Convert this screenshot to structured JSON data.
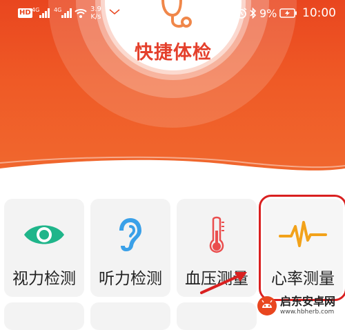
{
  "status_bar": {
    "hd_badge": "HD",
    "signal_1_label": "4G",
    "signal_2_label": "4G",
    "net_speed_value": "3.9",
    "net_speed_unit": "K/s",
    "battery_percent": "9%",
    "time": "10:00"
  },
  "hero": {
    "quick_check_label": "快捷体检"
  },
  "tiles": [
    {
      "label": "视力检测",
      "icon": "eye-icon",
      "color": "#1fb58a"
    },
    {
      "label": "听力检测",
      "icon": "ear-icon",
      "color": "#3aa0e8"
    },
    {
      "label": "血压测量",
      "icon": "thermometer-icon",
      "color": "#ea4d4d"
    },
    {
      "label": "心率测量",
      "icon": "heartbeat-icon",
      "color": "#f2a21a"
    }
  ],
  "selected_tile": "心率测量",
  "watermark": {
    "name": "启东安卓网",
    "url": "www.hbherb.com"
  },
  "colors": {
    "hero_orange": "#ef5a26",
    "accent_red": "#e4402c",
    "highlight_box": "#d92020"
  }
}
